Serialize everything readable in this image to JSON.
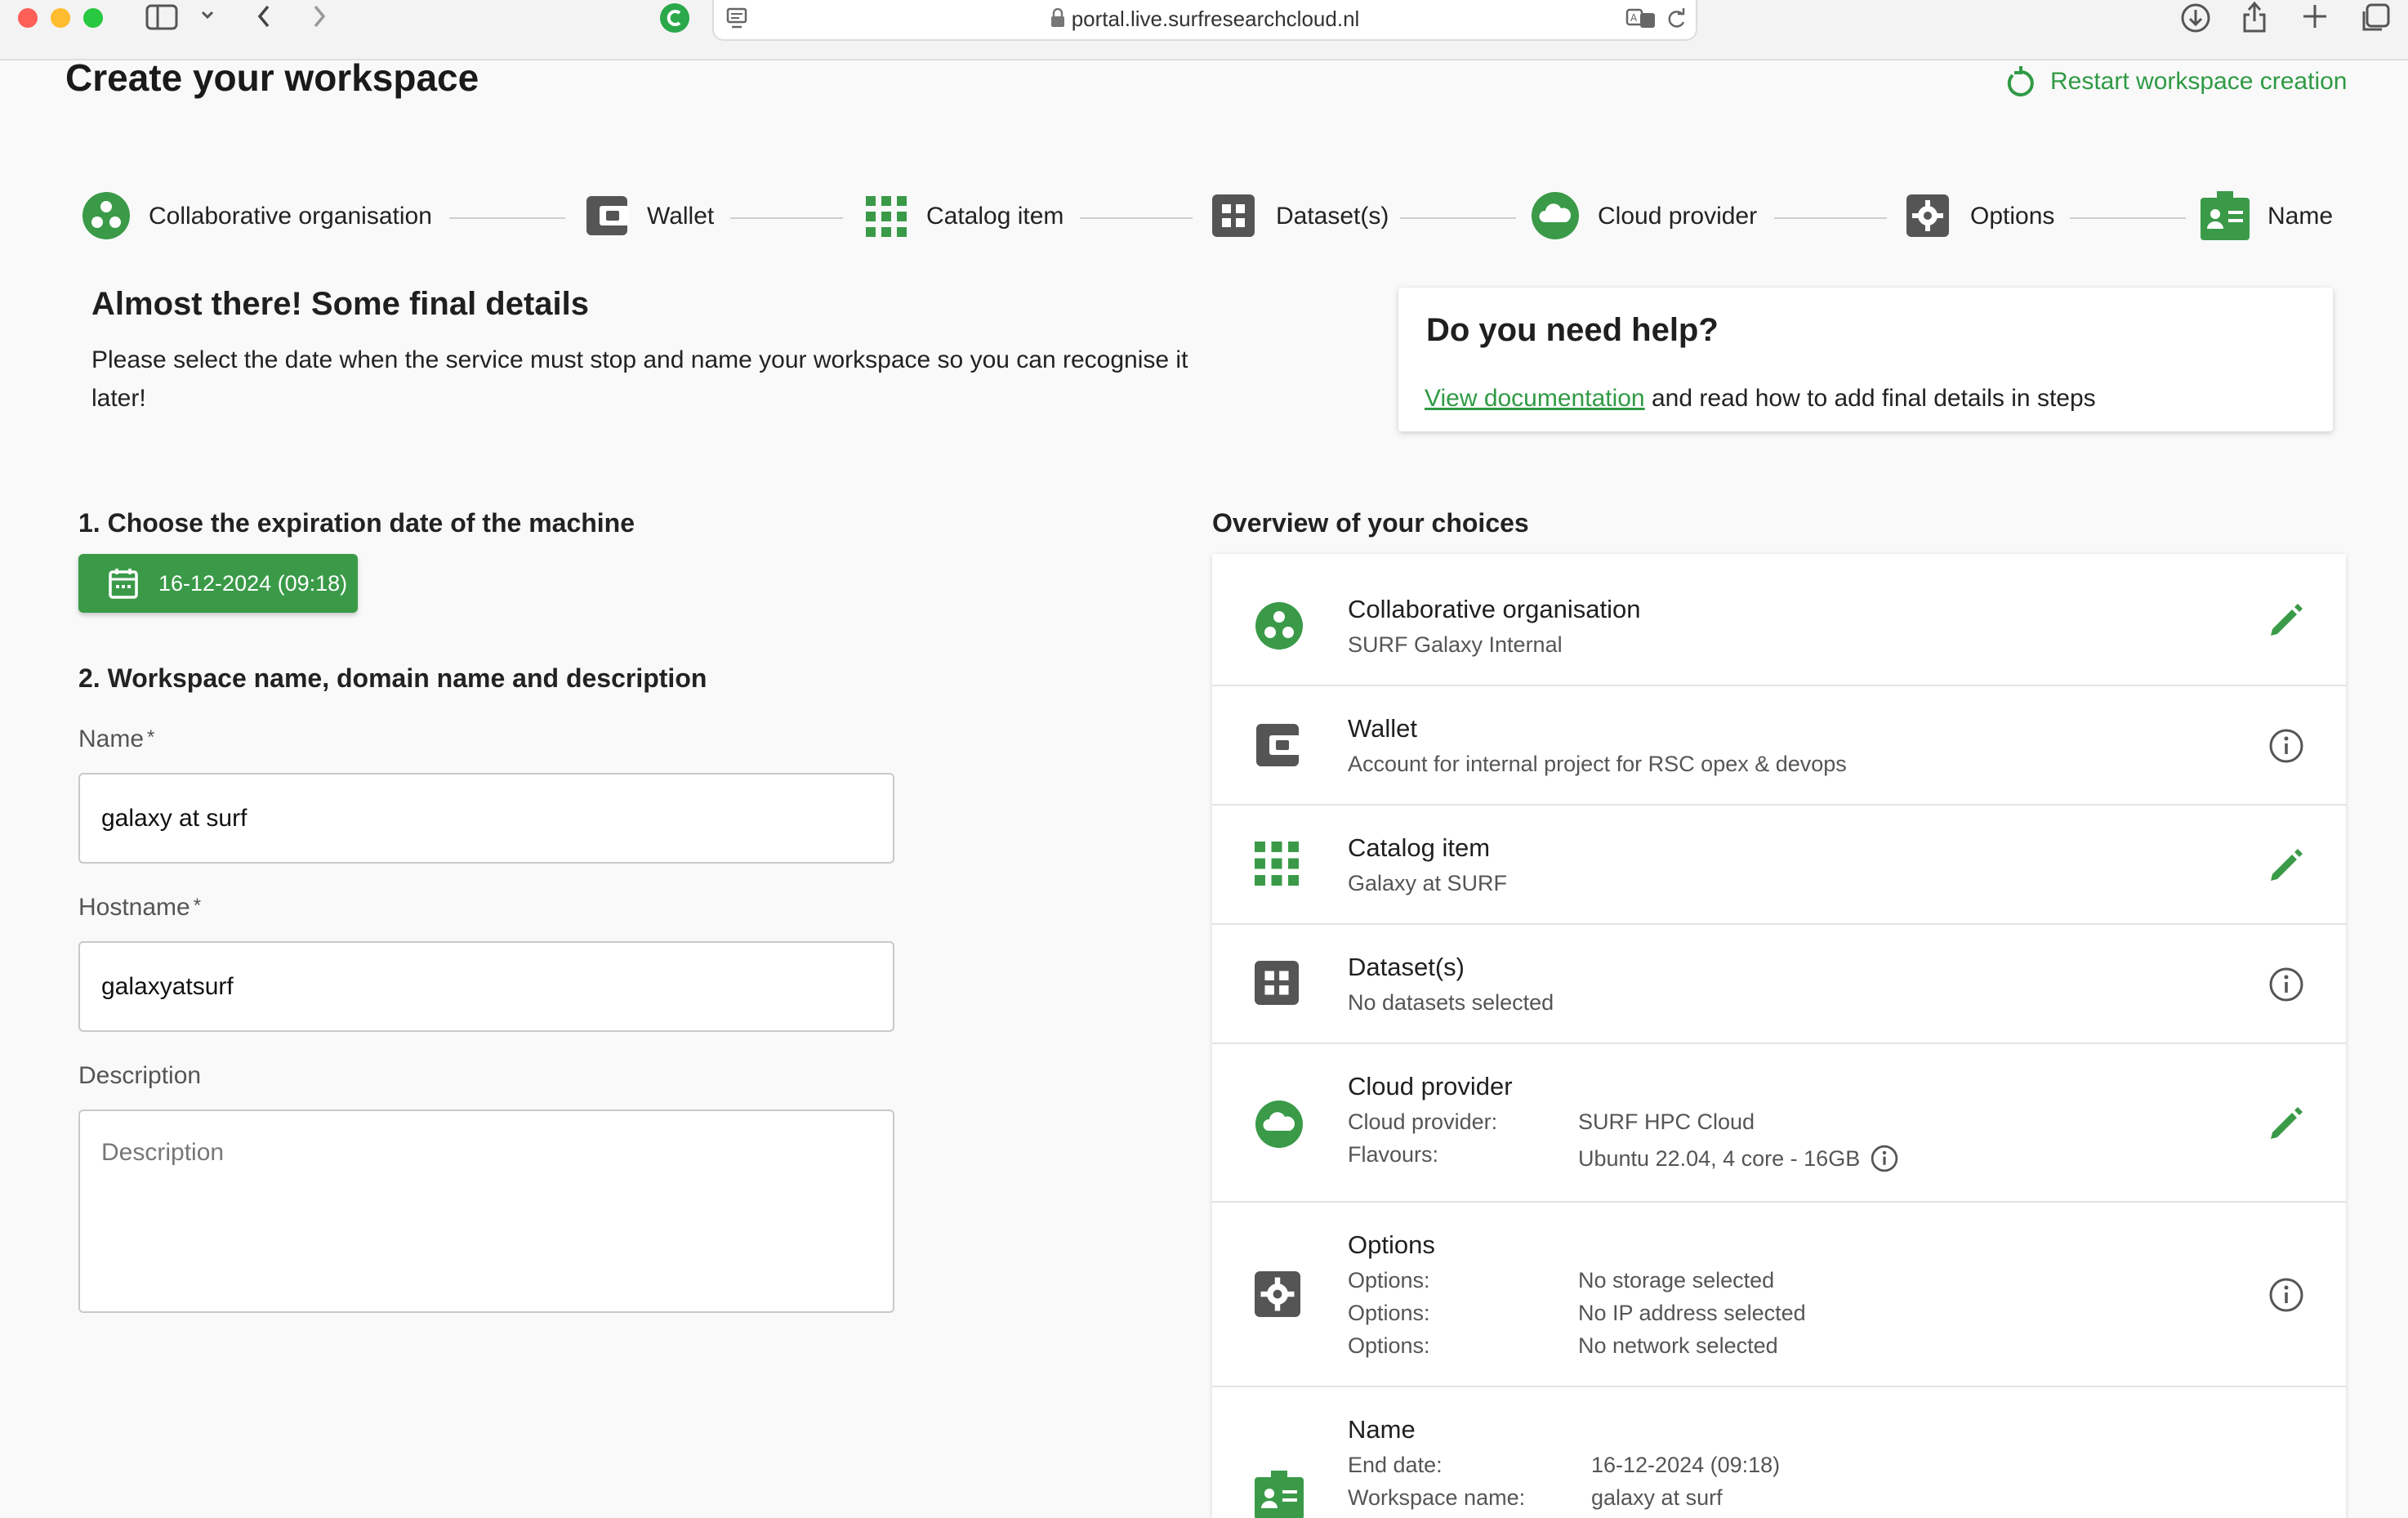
{
  "browser": {
    "url": "portal.live.surfresearchcloud.nl"
  },
  "page": {
    "title": "Create your workspace",
    "restart_label": "Restart workspace creation"
  },
  "steps": [
    {
      "label": "Collaborative organisation",
      "icon": "collaborative-organisation-icon"
    },
    {
      "label": "Wallet",
      "icon": "wallet-icon"
    },
    {
      "label": "Catalog item",
      "icon": "catalog-grid-icon"
    },
    {
      "label": "Dataset(s)",
      "icon": "dataset-icon"
    },
    {
      "label": "Cloud provider",
      "icon": "cloud-icon"
    },
    {
      "label": "Options",
      "icon": "gear-icon"
    },
    {
      "label": "Name",
      "icon": "id-badge-icon"
    }
  ],
  "intro": {
    "title": "Almost there! Some final details",
    "text_line1": "Please select the date when the service must stop and name your workspace so you can recognise it",
    "text_line2": "later!"
  },
  "help": {
    "title": "Do you need help?",
    "link_text": "View documentation",
    "rest_text": "and read how to add final details in steps"
  },
  "expiration": {
    "heading": "1. Choose the expiration date of the machine",
    "date_value": "16-12-2024 (09:18)"
  },
  "workspace": {
    "heading": "2. Workspace name, domain name and description",
    "name_label": "Name",
    "name_value": "galaxy at surf",
    "hostname_label": "Hostname",
    "hostname_value": "galaxyatsurf",
    "required_mark": "*",
    "description_label": "Description",
    "description_placeholder": "Description"
  },
  "overview": {
    "heading": "Overview of your choices",
    "collab": {
      "title": "Collaborative organisation",
      "sub": "SURF Galaxy Internal"
    },
    "wallet": {
      "title": "Wallet",
      "sub": "Account for internal project for RSC opex & devops"
    },
    "catalog": {
      "title": "Catalog item",
      "sub": "Galaxy at SURF"
    },
    "datasets": {
      "title": "Dataset(s)",
      "sub": "No datasets selected"
    },
    "cloud": {
      "title": "Cloud provider",
      "rows": [
        {
          "label": "Cloud provider:",
          "value": "SURF HPC Cloud"
        },
        {
          "label": "Flavours:",
          "value": "Ubuntu 22.04, 4 core - 16GB"
        }
      ]
    },
    "options": {
      "title": "Options",
      "rows": [
        {
          "label": "Options:",
          "value": "No storage selected"
        },
        {
          "label": "Options:",
          "value": "No IP address selected"
        },
        {
          "label": "Options:",
          "value": "No network selected"
        }
      ]
    },
    "name": {
      "title": "Name",
      "rows": [
        {
          "label": "End date:",
          "value": "16-12-2024 (09:18)"
        },
        {
          "label": "Workspace name:",
          "value": "galaxy at surf"
        }
      ]
    }
  },
  "colors": {
    "accent": "#3a9a48",
    "link": "#2f9a44",
    "icon_gray": "#555555"
  }
}
